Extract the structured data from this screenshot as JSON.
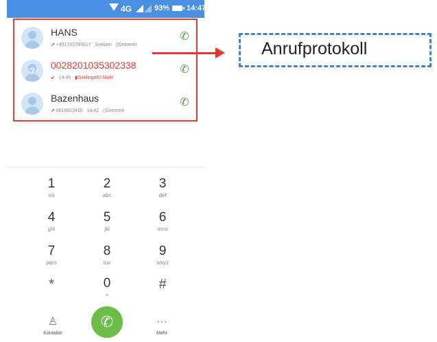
{
  "statusbar": {
    "network": "4G",
    "battery": "93%",
    "time": "14:47"
  },
  "call_log": [
    {
      "name": "HANS",
      "missed": false,
      "number": "+491702793617",
      "time": "Soeben",
      "status": "Getrennt"
    },
    {
      "name": "0028201035302338",
      "missed": true,
      "time": "14:45",
      "status": "Geklingelt2 Male"
    },
    {
      "name": "Bazenhaus",
      "missed": false,
      "number": "0619623430",
      "time": "14:42",
      "status": "Getrennt"
    }
  ],
  "dialpad": [
    {
      "num": "1",
      "let": "σο"
    },
    {
      "num": "2",
      "let": "abc"
    },
    {
      "num": "3",
      "let": "def"
    },
    {
      "num": "4",
      "let": "ghi"
    },
    {
      "num": "5",
      "let": "jkl"
    },
    {
      "num": "6",
      "let": "mno"
    },
    {
      "num": "7",
      "let": "pqrs"
    },
    {
      "num": "8",
      "let": "tuv"
    },
    {
      "num": "9",
      "let": "wxyz"
    },
    {
      "num": "*",
      "let": ""
    },
    {
      "num": "0",
      "let": "+"
    },
    {
      "num": "#",
      "let": ""
    }
  ],
  "bottom": {
    "contacts_label": "Kontakte",
    "more_label": "Mehr",
    "more_icon": "···"
  },
  "annotation": {
    "label": "Anrufprotokoll"
  },
  "colors": {
    "accent_blue": "#4a90e2",
    "call_green": "#6cbd45",
    "highlight_red": "#e53935"
  }
}
